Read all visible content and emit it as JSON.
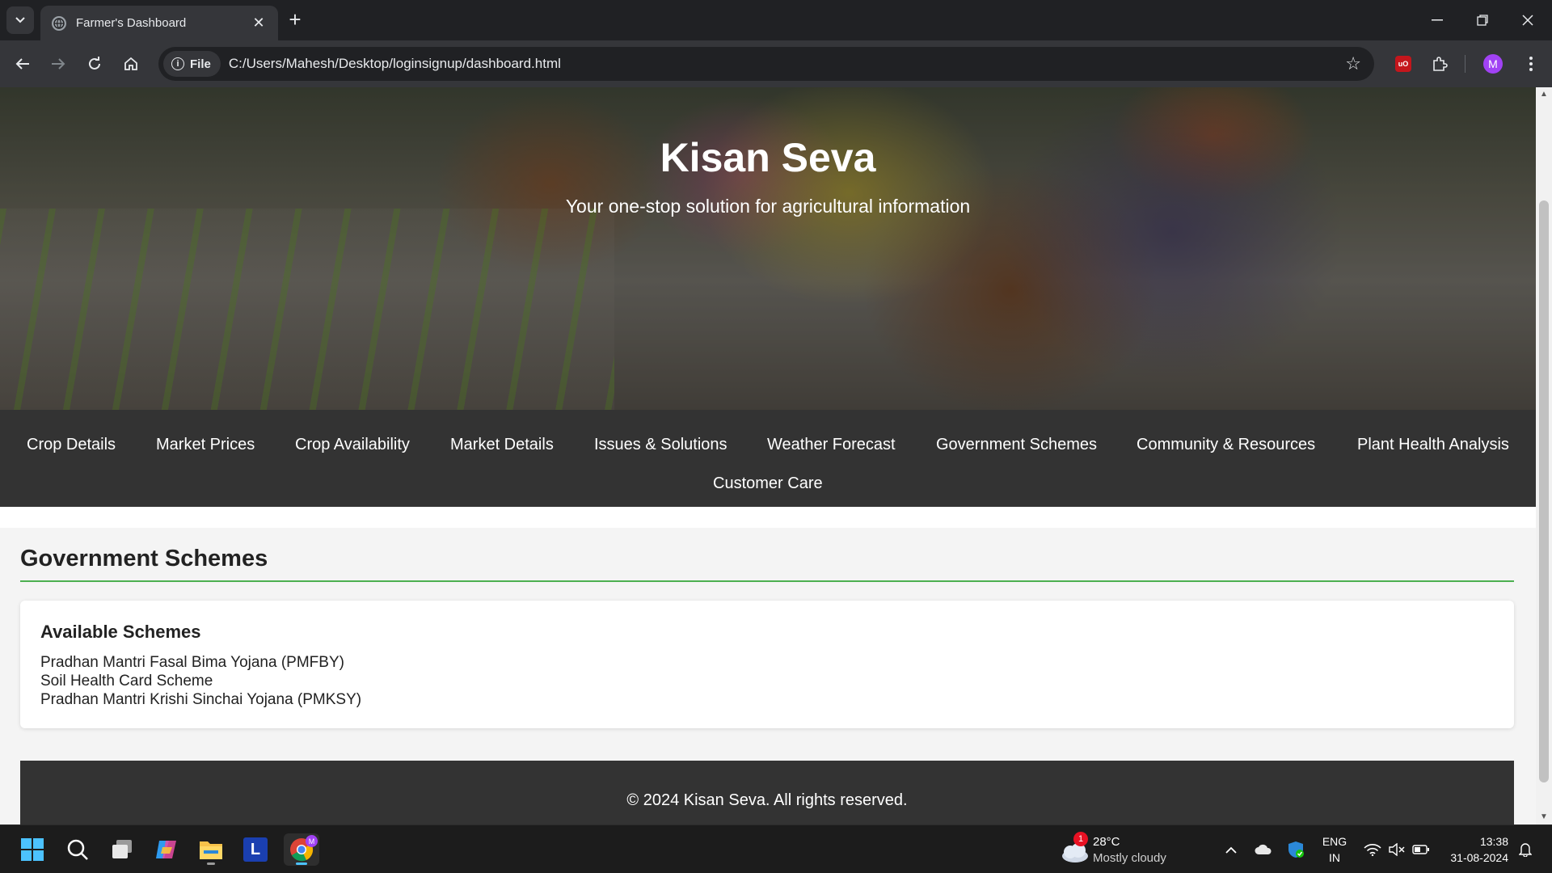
{
  "browser": {
    "tab_title": "Farmer's Dashboard",
    "chip_label": "File",
    "url": "C:/Users/Mahesh/Desktop/loginsignup/dashboard.html",
    "profile_initial": "M",
    "ublock_label": "uO"
  },
  "hero": {
    "title": "Kisan Seva",
    "subtitle": "Your one-stop solution for agricultural information"
  },
  "nav": {
    "items": [
      "Crop Details",
      "Market Prices",
      "Crop Availability",
      "Market Details",
      "Issues & Solutions",
      "Weather Forecast",
      "Government Schemes",
      "Community & Resources",
      "Plant Health Analysis",
      "Customer Care"
    ]
  },
  "section": {
    "title": "Government Schemes",
    "card_title": "Available Schemes",
    "schemes": [
      "Pradhan Mantri Fasal Bima Yojana (PMFBY)",
      "Soil Health Card Scheme",
      "Pradhan Mantri Krishi Sinchai Yojana (PMKSY)"
    ]
  },
  "footer": {
    "text": "© 2024 Kisan Seva. All rights reserved."
  },
  "taskbar": {
    "weather_temp": "28°C",
    "weather_desc": "Mostly cloudy",
    "weather_badge": "1",
    "lang_line1": "ENG",
    "lang_line2": "IN",
    "time": "13:38",
    "date": "31-08-2024",
    "chrome_profile_badge": "M",
    "app_l_label": "L"
  },
  "colors": {
    "accent_green": "#4caf50",
    "nav_bg": "#333333",
    "chrome_dark": "#202124"
  }
}
